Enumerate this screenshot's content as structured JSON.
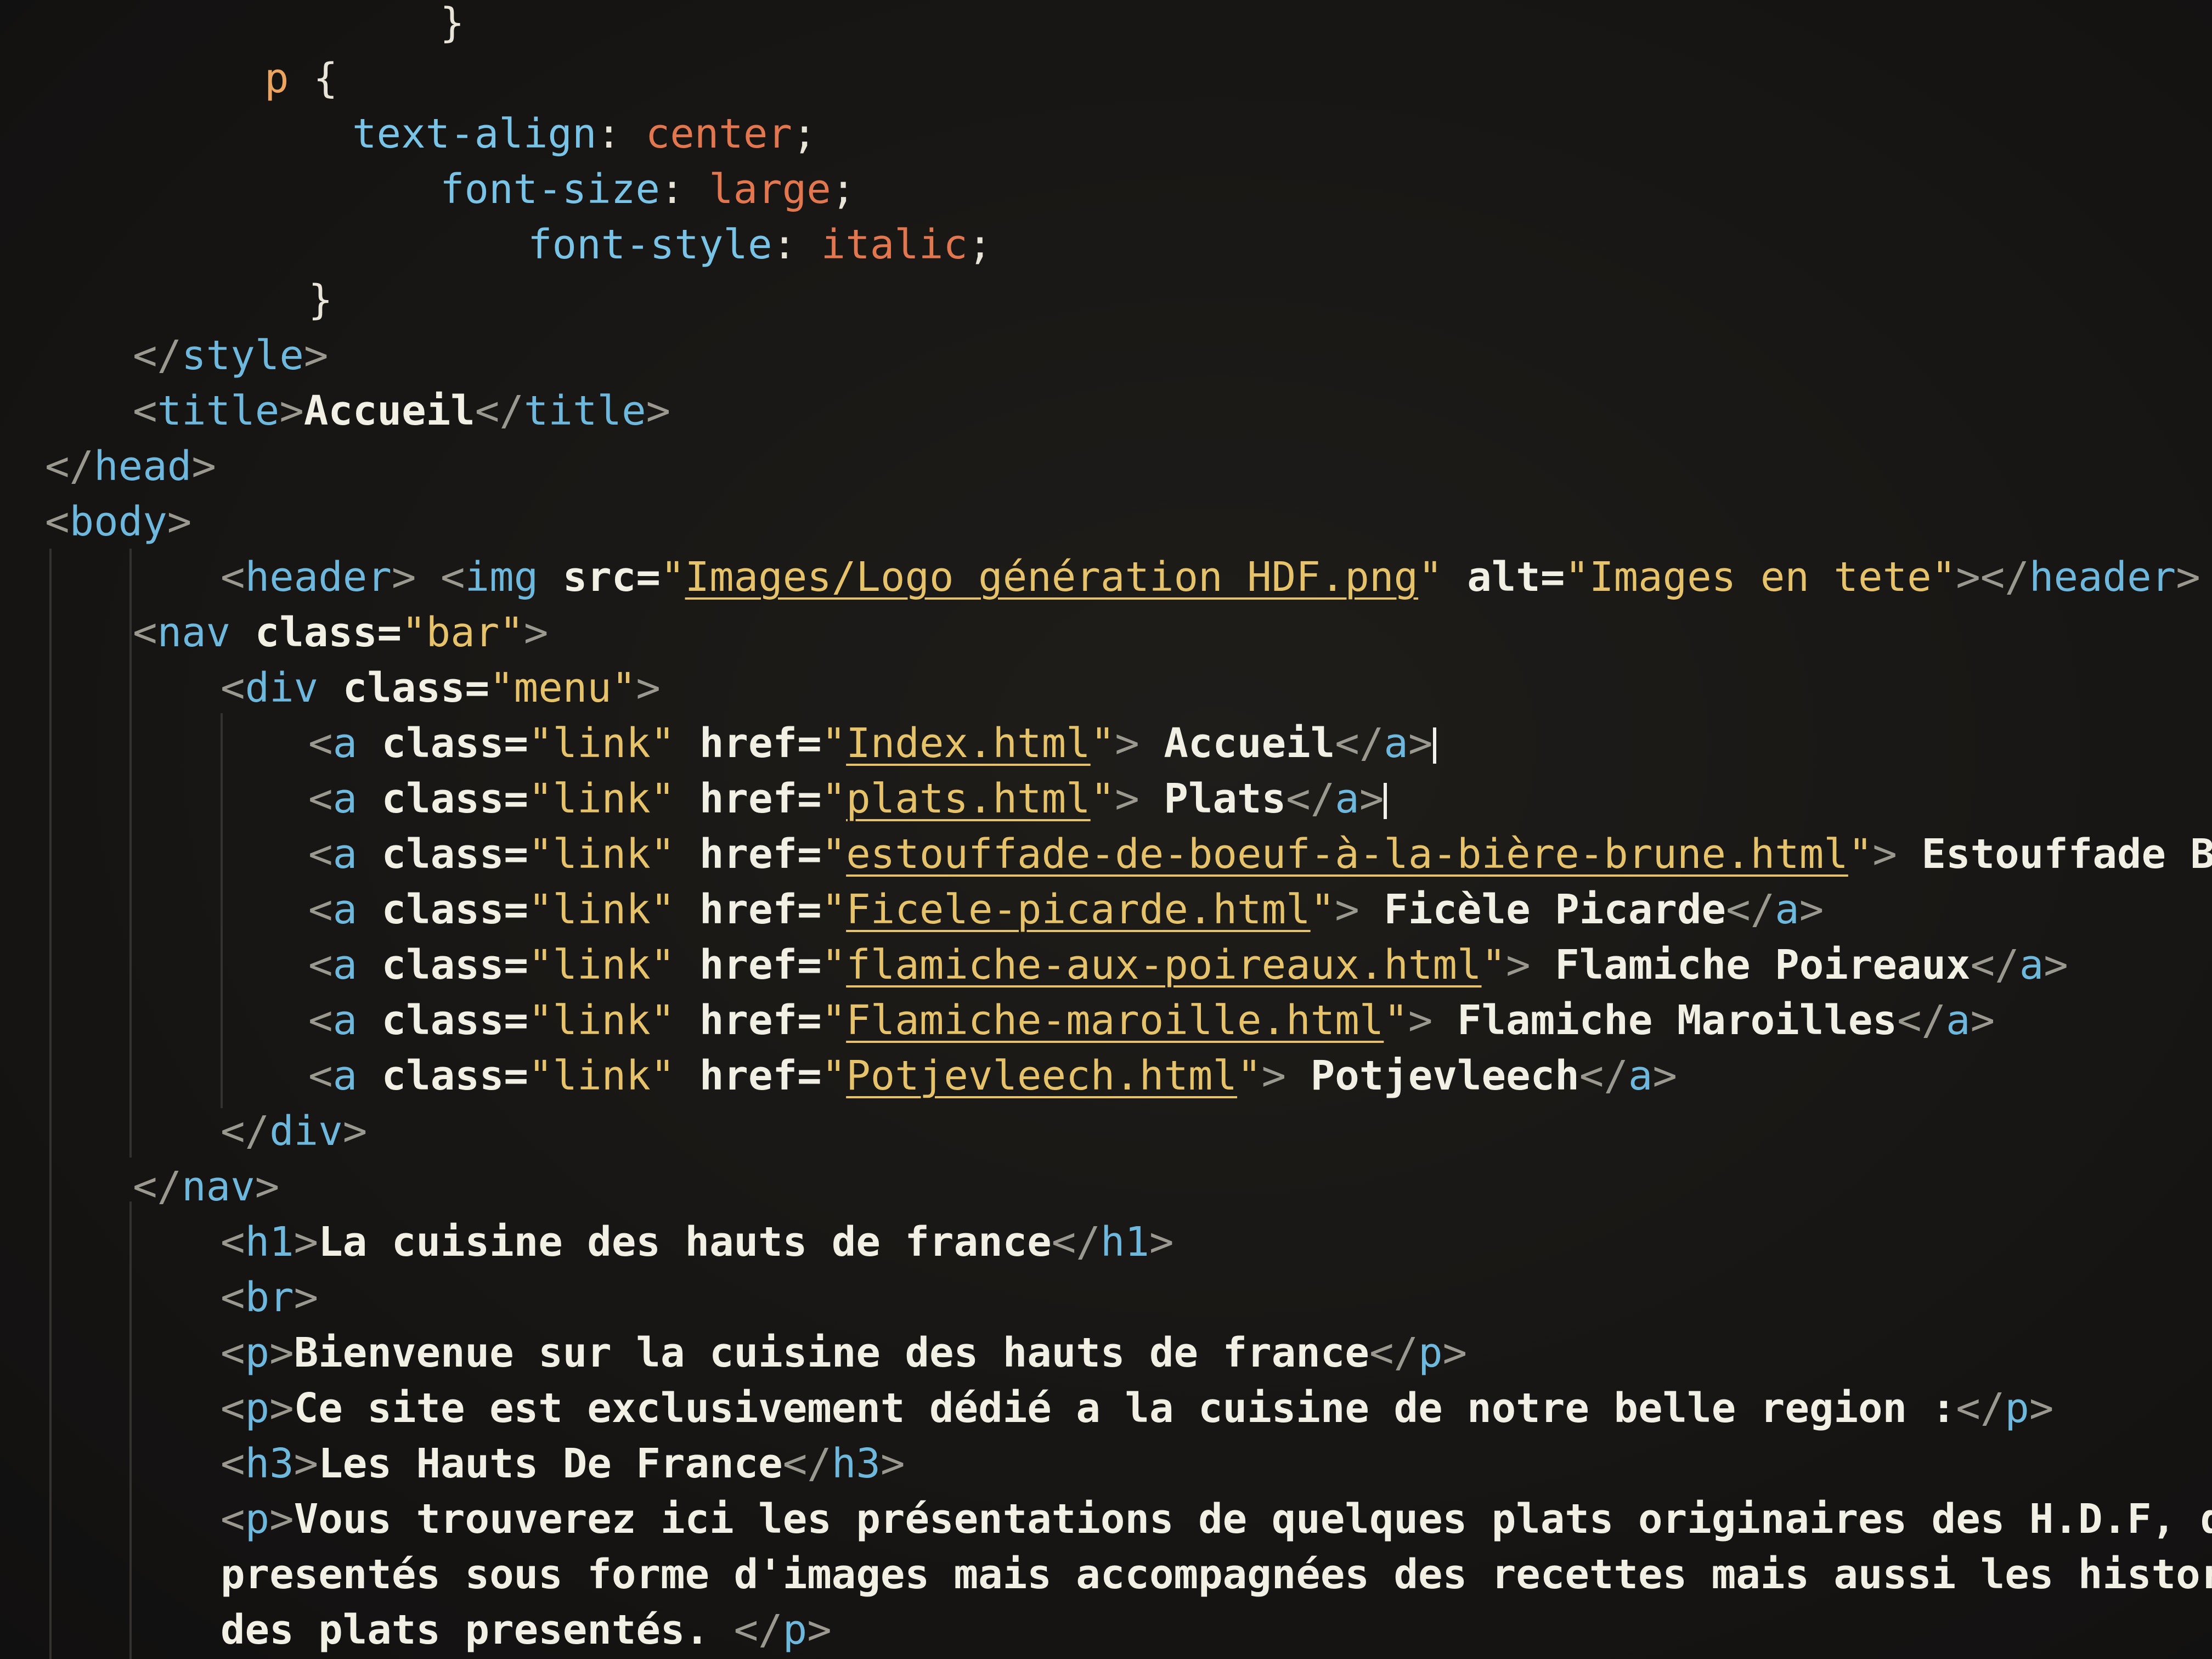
{
  "editor": {
    "lines": [
      {
        "indent": 9,
        "tokens": [
          [
            "}",
            "punct"
          ]
        ]
      },
      {
        "indent": 5,
        "tokens": [
          [
            "p",
            "sel"
          ],
          [
            " {",
            "punct"
          ]
        ]
      },
      {
        "indent": 7,
        "tokens": [
          [
            "text-align",
            "prop"
          ],
          [
            ": ",
            "punct"
          ],
          [
            "center",
            "val"
          ],
          [
            ";",
            "punct"
          ]
        ]
      },
      {
        "indent": 9,
        "tokens": [
          [
            "font-size",
            "prop"
          ],
          [
            ": ",
            "punct"
          ],
          [
            "large",
            "val"
          ],
          [
            ";",
            "punct"
          ]
        ]
      },
      {
        "indent": 11,
        "tokens": [
          [
            "font-style",
            "prop"
          ],
          [
            ": ",
            "punct"
          ],
          [
            "italic",
            "val"
          ],
          [
            ";",
            "punct"
          ]
        ]
      },
      {
        "indent": 6,
        "tokens": [
          [
            "}",
            "punct"
          ]
        ]
      },
      {
        "indent": 2,
        "tokens": [
          [
            "</",
            "br"
          ],
          [
            "style",
            "tag"
          ],
          [
            ">",
            "br"
          ]
        ]
      },
      {
        "indent": 2,
        "tokens": [
          [
            "<",
            "br"
          ],
          [
            "title",
            "tag"
          ],
          [
            ">",
            "br"
          ],
          [
            "Accueil",
            "text"
          ],
          [
            "</",
            "br"
          ],
          [
            "title",
            "tag"
          ],
          [
            ">",
            "br"
          ]
        ]
      },
      {
        "indent": 0,
        "tokens": [
          [
            "</",
            "br"
          ],
          [
            "head",
            "tag"
          ],
          [
            ">",
            "br"
          ]
        ]
      },
      {
        "indent": 0,
        "tokens": [
          [
            "<",
            "br"
          ],
          [
            "body",
            "tag"
          ],
          [
            ">",
            "br"
          ]
        ]
      },
      {
        "indent": 4,
        "tokens": [
          [
            "<",
            "br"
          ],
          [
            "header",
            "tag"
          ],
          [
            ">",
            "br"
          ],
          [
            " <",
            "br"
          ],
          [
            "img",
            "tag"
          ],
          [
            " src=",
            "attr"
          ],
          [
            "\"",
            "str"
          ],
          [
            "Images/Logo génération HDF.png",
            "link"
          ],
          [
            "\"",
            "str"
          ],
          [
            " alt=",
            "attr"
          ],
          [
            "\"Images en tete\"",
            "str"
          ],
          [
            "></",
            "br"
          ],
          [
            "header",
            "tag"
          ],
          [
            ">",
            "br"
          ]
        ]
      },
      {
        "indent": 2,
        "tokens": [
          [
            "<",
            "br"
          ],
          [
            "nav",
            "tag"
          ],
          [
            " class=",
            "attr"
          ],
          [
            "\"bar\"",
            "str"
          ],
          [
            ">",
            "br"
          ]
        ]
      },
      {
        "indent": 4,
        "tokens": [
          [
            "<",
            "br"
          ],
          [
            "div",
            "tag"
          ],
          [
            " class=",
            "attr"
          ],
          [
            "\"menu\"",
            "str"
          ],
          [
            ">",
            "br"
          ]
        ]
      },
      {
        "indent": 6,
        "tokens": [
          [
            "<",
            "br"
          ],
          [
            "a",
            "tag"
          ],
          [
            " class=",
            "attr"
          ],
          [
            "\"link\"",
            "str"
          ],
          [
            " href=",
            "attr"
          ],
          [
            "\"",
            "str"
          ],
          [
            "Index.html",
            "link"
          ],
          [
            "\"",
            "str"
          ],
          [
            "> ",
            "br"
          ],
          [
            "Accueil",
            "text"
          ],
          [
            "</",
            "br"
          ],
          [
            "a",
            "tag"
          ],
          [
            ">",
            "br"
          ],
          [
            "|",
            "caret"
          ]
        ]
      },
      {
        "indent": 6,
        "tokens": [
          [
            "<",
            "br"
          ],
          [
            "a",
            "tag"
          ],
          [
            " class=",
            "attr"
          ],
          [
            "\"link\"",
            "str"
          ],
          [
            " href=",
            "attr"
          ],
          [
            "\"",
            "str"
          ],
          [
            "plats.html",
            "link"
          ],
          [
            "\"",
            "str"
          ],
          [
            "> ",
            "br"
          ],
          [
            "Plats",
            "text"
          ],
          [
            "</",
            "br"
          ],
          [
            "a",
            "tag"
          ],
          [
            ">",
            "br"
          ],
          [
            "|",
            "caret"
          ]
        ]
      },
      {
        "indent": 6,
        "tokens": [
          [
            "<",
            "br"
          ],
          [
            "a",
            "tag"
          ],
          [
            " class=",
            "attr"
          ],
          [
            "\"link\"",
            "str"
          ],
          [
            " href=",
            "attr"
          ],
          [
            "\"",
            "str"
          ],
          [
            "estouffade-de-boeuf-à-la-bière-brune.html",
            "link"
          ],
          [
            "\"",
            "str"
          ],
          [
            "> ",
            "br"
          ],
          [
            "Estouffade Boeuf",
            "text"
          ],
          [
            "</",
            "br"
          ],
          [
            "a",
            "tag"
          ],
          [
            ">",
            "br"
          ]
        ]
      },
      {
        "indent": 6,
        "tokens": [
          [
            "<",
            "br"
          ],
          [
            "a",
            "tag"
          ],
          [
            " class=",
            "attr"
          ],
          [
            "\"link\"",
            "str"
          ],
          [
            " href=",
            "attr"
          ],
          [
            "\"",
            "str"
          ],
          [
            "Ficele-picarde.html",
            "link"
          ],
          [
            "\"",
            "str"
          ],
          [
            "> ",
            "br"
          ],
          [
            "Ficèle Picarde",
            "text"
          ],
          [
            "</",
            "br"
          ],
          [
            "a",
            "tag"
          ],
          [
            ">",
            "br"
          ]
        ]
      },
      {
        "indent": 6,
        "tokens": [
          [
            "<",
            "br"
          ],
          [
            "a",
            "tag"
          ],
          [
            " class=",
            "attr"
          ],
          [
            "\"link\"",
            "str"
          ],
          [
            " href=",
            "attr"
          ],
          [
            "\"",
            "str"
          ],
          [
            "flamiche-aux-poireaux.html",
            "link"
          ],
          [
            "\"",
            "str"
          ],
          [
            "> ",
            "br"
          ],
          [
            "Flamiche Poireaux",
            "text"
          ],
          [
            "</",
            "br"
          ],
          [
            "a",
            "tag"
          ],
          [
            ">",
            "br"
          ]
        ]
      },
      {
        "indent": 6,
        "tokens": [
          [
            "<",
            "br"
          ],
          [
            "a",
            "tag"
          ],
          [
            " class=",
            "attr"
          ],
          [
            "\"link\"",
            "str"
          ],
          [
            " href=",
            "attr"
          ],
          [
            "\"",
            "str"
          ],
          [
            "Flamiche-maroille.html",
            "link"
          ],
          [
            "\"",
            "str"
          ],
          [
            "> ",
            "br"
          ],
          [
            "Flamiche Maroilles",
            "text"
          ],
          [
            "</",
            "br"
          ],
          [
            "a",
            "tag"
          ],
          [
            ">",
            "br"
          ]
        ]
      },
      {
        "indent": 6,
        "tokens": [
          [
            "<",
            "br"
          ],
          [
            "a",
            "tag"
          ],
          [
            " class=",
            "attr"
          ],
          [
            "\"link\"",
            "str"
          ],
          [
            " href=",
            "attr"
          ],
          [
            "\"",
            "str"
          ],
          [
            "Potjevleech.html",
            "link"
          ],
          [
            "\"",
            "str"
          ],
          [
            "> ",
            "br"
          ],
          [
            "Potjevleech",
            "text"
          ],
          [
            "</",
            "br"
          ],
          [
            "a",
            "tag"
          ],
          [
            ">",
            "br"
          ]
        ]
      },
      {
        "indent": 4,
        "tokens": [
          [
            "</",
            "br"
          ],
          [
            "div",
            "tag"
          ],
          [
            ">",
            "br"
          ]
        ]
      },
      {
        "indent": 2,
        "tokens": [
          [
            "</",
            "br"
          ],
          [
            "nav",
            "tag"
          ],
          [
            ">",
            "br"
          ]
        ]
      },
      {
        "indent": 4,
        "tokens": [
          [
            "<",
            "br"
          ],
          [
            "h1",
            "tag"
          ],
          [
            ">",
            "br"
          ],
          [
            "La cuisine des hauts de france",
            "text"
          ],
          [
            "</",
            "br"
          ],
          [
            "h1",
            "tag"
          ],
          [
            ">",
            "br"
          ]
        ]
      },
      {
        "indent": 4,
        "tokens": [
          [
            "<",
            "br"
          ],
          [
            "br",
            "tag"
          ],
          [
            ">",
            "br"
          ]
        ]
      },
      {
        "indent": 4,
        "tokens": [
          [
            "<",
            "br"
          ],
          [
            "p",
            "tag"
          ],
          [
            ">",
            "br"
          ],
          [
            "Bienvenue sur la cuisine des hauts de france",
            "text"
          ],
          [
            "</",
            "br"
          ],
          [
            "p",
            "tag"
          ],
          [
            ">",
            "br"
          ]
        ]
      },
      {
        "indent": 4,
        "tokens": [
          [
            "<",
            "br"
          ],
          [
            "p",
            "tag"
          ],
          [
            ">",
            "br"
          ],
          [
            "Ce site est exclusivement dédié a la cuisine de notre belle region :",
            "text"
          ],
          [
            "</",
            "br"
          ],
          [
            "p",
            "tag"
          ],
          [
            ">",
            "br"
          ]
        ]
      },
      {
        "indent": 4,
        "tokens": [
          [
            "<",
            "br"
          ],
          [
            "h3",
            "tag"
          ],
          [
            ">",
            "br"
          ],
          [
            "Les Hauts De France",
            "text"
          ],
          [
            "</",
            "br"
          ],
          [
            "h3",
            "tag"
          ],
          [
            ">",
            "br"
          ]
        ]
      },
      {
        "indent": 4,
        "tokens": [
          [
            "<",
            "br"
          ],
          [
            "p",
            "tag"
          ],
          [
            ">",
            "br"
          ],
          [
            "Vous trouverez ici les présentations de quelques plats originaires des H.D.F, qui vous s",
            "text"
          ]
        ]
      },
      {
        "indent": 4,
        "tokens": [
          [
            "presentés sous forme d'images mais accompagnées des recettes mais aussi les historiques de",
            "text"
          ]
        ]
      },
      {
        "indent": 4,
        "tokens": [
          [
            "des plats presentés. ",
            "text"
          ],
          [
            "</",
            "br"
          ],
          [
            "p",
            "tag"
          ],
          [
            ">",
            "br"
          ]
        ]
      }
    ]
  }
}
